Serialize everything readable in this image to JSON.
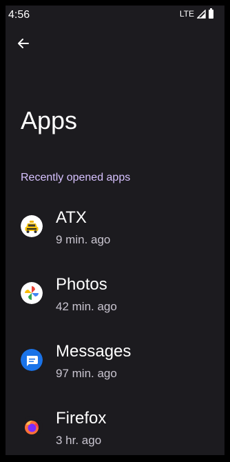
{
  "status_bar": {
    "time": "4:56",
    "network": "LTE"
  },
  "header": {
    "title": "Apps"
  },
  "section": {
    "title": "Recently opened apps"
  },
  "apps": [
    {
      "name": "ATX",
      "time": "9 min. ago",
      "icon": "taxi-icon"
    },
    {
      "name": "Photos",
      "time": "42 min. ago",
      "icon": "photos-pinwheel-icon"
    },
    {
      "name": "Messages",
      "time": "97 min. ago",
      "icon": "messages-icon"
    },
    {
      "name": "Firefox",
      "time": "3 hr. ago",
      "icon": "firefox-icon"
    }
  ],
  "colors": {
    "background": "#1c1b1f",
    "section_header": "#d7c2ff",
    "primary_text": "#ffffff",
    "secondary_text": "#c9c5d0"
  }
}
